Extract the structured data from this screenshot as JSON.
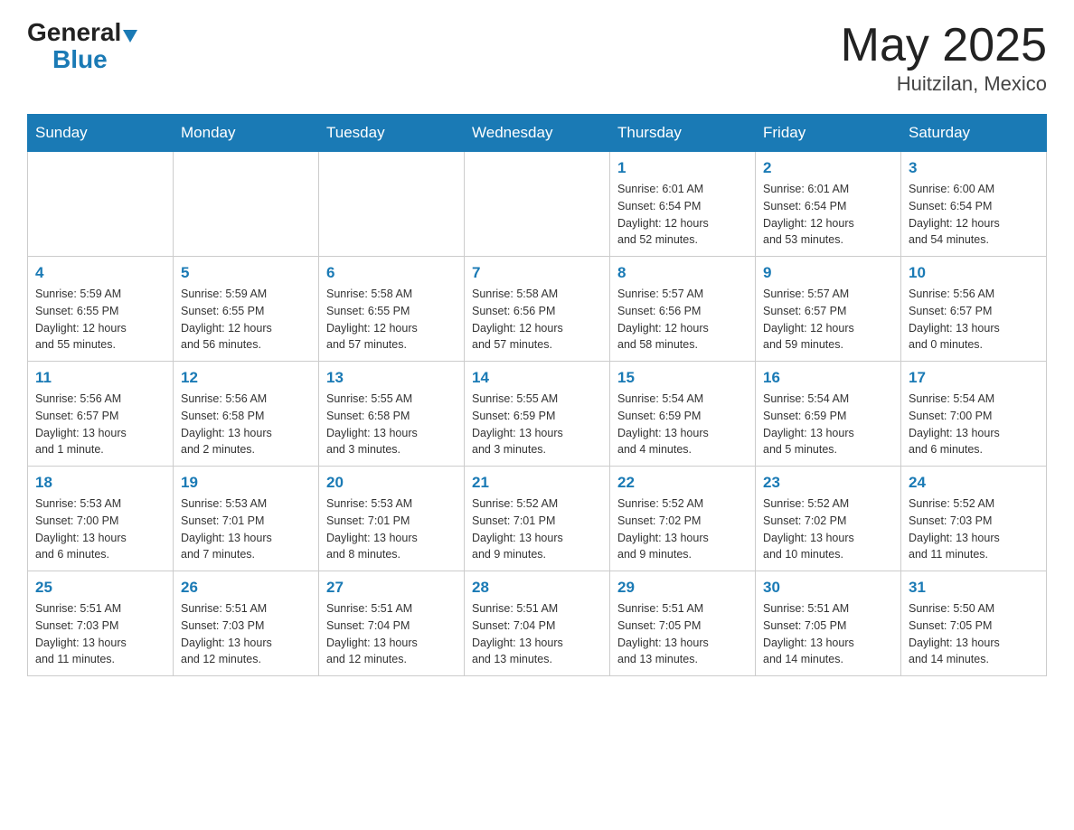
{
  "header": {
    "logo_general": "General",
    "logo_blue": "Blue",
    "month_title": "May 2025",
    "location": "Huitzilan, Mexico"
  },
  "calendar": {
    "days_of_week": [
      "Sunday",
      "Monday",
      "Tuesday",
      "Wednesday",
      "Thursday",
      "Friday",
      "Saturday"
    ],
    "weeks": [
      [
        {
          "day": "",
          "info": ""
        },
        {
          "day": "",
          "info": ""
        },
        {
          "day": "",
          "info": ""
        },
        {
          "day": "",
          "info": ""
        },
        {
          "day": "1",
          "info": "Sunrise: 6:01 AM\nSunset: 6:54 PM\nDaylight: 12 hours\nand 52 minutes."
        },
        {
          "day": "2",
          "info": "Sunrise: 6:01 AM\nSunset: 6:54 PM\nDaylight: 12 hours\nand 53 minutes."
        },
        {
          "day": "3",
          "info": "Sunrise: 6:00 AM\nSunset: 6:54 PM\nDaylight: 12 hours\nand 54 minutes."
        }
      ],
      [
        {
          "day": "4",
          "info": "Sunrise: 5:59 AM\nSunset: 6:55 PM\nDaylight: 12 hours\nand 55 minutes."
        },
        {
          "day": "5",
          "info": "Sunrise: 5:59 AM\nSunset: 6:55 PM\nDaylight: 12 hours\nand 56 minutes."
        },
        {
          "day": "6",
          "info": "Sunrise: 5:58 AM\nSunset: 6:55 PM\nDaylight: 12 hours\nand 57 minutes."
        },
        {
          "day": "7",
          "info": "Sunrise: 5:58 AM\nSunset: 6:56 PM\nDaylight: 12 hours\nand 57 minutes."
        },
        {
          "day": "8",
          "info": "Sunrise: 5:57 AM\nSunset: 6:56 PM\nDaylight: 12 hours\nand 58 minutes."
        },
        {
          "day": "9",
          "info": "Sunrise: 5:57 AM\nSunset: 6:57 PM\nDaylight: 12 hours\nand 59 minutes."
        },
        {
          "day": "10",
          "info": "Sunrise: 5:56 AM\nSunset: 6:57 PM\nDaylight: 13 hours\nand 0 minutes."
        }
      ],
      [
        {
          "day": "11",
          "info": "Sunrise: 5:56 AM\nSunset: 6:57 PM\nDaylight: 13 hours\nand 1 minute."
        },
        {
          "day": "12",
          "info": "Sunrise: 5:56 AM\nSunset: 6:58 PM\nDaylight: 13 hours\nand 2 minutes."
        },
        {
          "day": "13",
          "info": "Sunrise: 5:55 AM\nSunset: 6:58 PM\nDaylight: 13 hours\nand 3 minutes."
        },
        {
          "day": "14",
          "info": "Sunrise: 5:55 AM\nSunset: 6:59 PM\nDaylight: 13 hours\nand 3 minutes."
        },
        {
          "day": "15",
          "info": "Sunrise: 5:54 AM\nSunset: 6:59 PM\nDaylight: 13 hours\nand 4 minutes."
        },
        {
          "day": "16",
          "info": "Sunrise: 5:54 AM\nSunset: 6:59 PM\nDaylight: 13 hours\nand 5 minutes."
        },
        {
          "day": "17",
          "info": "Sunrise: 5:54 AM\nSunset: 7:00 PM\nDaylight: 13 hours\nand 6 minutes."
        }
      ],
      [
        {
          "day": "18",
          "info": "Sunrise: 5:53 AM\nSunset: 7:00 PM\nDaylight: 13 hours\nand 6 minutes."
        },
        {
          "day": "19",
          "info": "Sunrise: 5:53 AM\nSunset: 7:01 PM\nDaylight: 13 hours\nand 7 minutes."
        },
        {
          "day": "20",
          "info": "Sunrise: 5:53 AM\nSunset: 7:01 PM\nDaylight: 13 hours\nand 8 minutes."
        },
        {
          "day": "21",
          "info": "Sunrise: 5:52 AM\nSunset: 7:01 PM\nDaylight: 13 hours\nand 9 minutes."
        },
        {
          "day": "22",
          "info": "Sunrise: 5:52 AM\nSunset: 7:02 PM\nDaylight: 13 hours\nand 9 minutes."
        },
        {
          "day": "23",
          "info": "Sunrise: 5:52 AM\nSunset: 7:02 PM\nDaylight: 13 hours\nand 10 minutes."
        },
        {
          "day": "24",
          "info": "Sunrise: 5:52 AM\nSunset: 7:03 PM\nDaylight: 13 hours\nand 11 minutes."
        }
      ],
      [
        {
          "day": "25",
          "info": "Sunrise: 5:51 AM\nSunset: 7:03 PM\nDaylight: 13 hours\nand 11 minutes."
        },
        {
          "day": "26",
          "info": "Sunrise: 5:51 AM\nSunset: 7:03 PM\nDaylight: 13 hours\nand 12 minutes."
        },
        {
          "day": "27",
          "info": "Sunrise: 5:51 AM\nSunset: 7:04 PM\nDaylight: 13 hours\nand 12 minutes."
        },
        {
          "day": "28",
          "info": "Sunrise: 5:51 AM\nSunset: 7:04 PM\nDaylight: 13 hours\nand 13 minutes."
        },
        {
          "day": "29",
          "info": "Sunrise: 5:51 AM\nSunset: 7:05 PM\nDaylight: 13 hours\nand 13 minutes."
        },
        {
          "day": "30",
          "info": "Sunrise: 5:51 AM\nSunset: 7:05 PM\nDaylight: 13 hours\nand 14 minutes."
        },
        {
          "day": "31",
          "info": "Sunrise: 5:50 AM\nSunset: 7:05 PM\nDaylight: 13 hours\nand 14 minutes."
        }
      ]
    ]
  }
}
